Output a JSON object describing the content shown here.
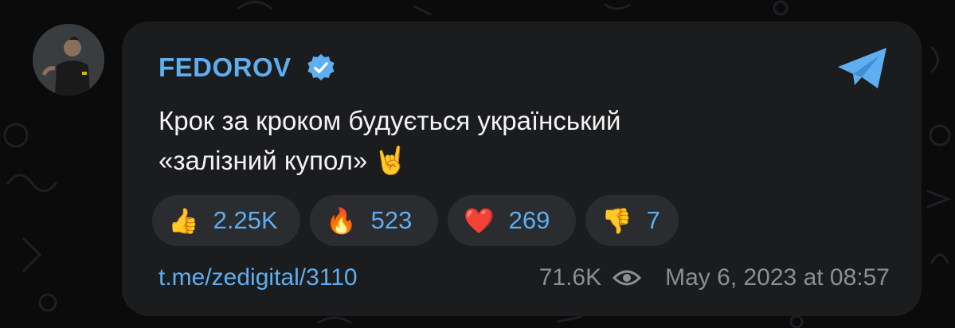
{
  "post": {
    "channel_name": "FEDOROV",
    "verified_icon": "verified-badge-icon",
    "share_icon": "telegram-share-icon",
    "message_line1": "Крок за кроком будується український",
    "message_line2": "«залізний купол»",
    "message_emoji": "🤘",
    "link": "t.me/zedigital/3110",
    "views": "71.6K",
    "views_icon": "eye-icon",
    "timestamp": "May 6, 2023 at 08:57"
  },
  "reactions": [
    {
      "emoji": "👍",
      "count": "2.25K"
    },
    {
      "emoji": "🔥",
      "count": "523"
    },
    {
      "emoji": "❤️",
      "count": "269"
    },
    {
      "emoji": "👎",
      "count": "7"
    }
  ],
  "colors": {
    "background": "#0b0b0c",
    "bubble": "#1b1c1e",
    "accent": "#5eaef0",
    "reaction_pill": "#2a2c2f",
    "meta_text": "#8c8e91"
  }
}
